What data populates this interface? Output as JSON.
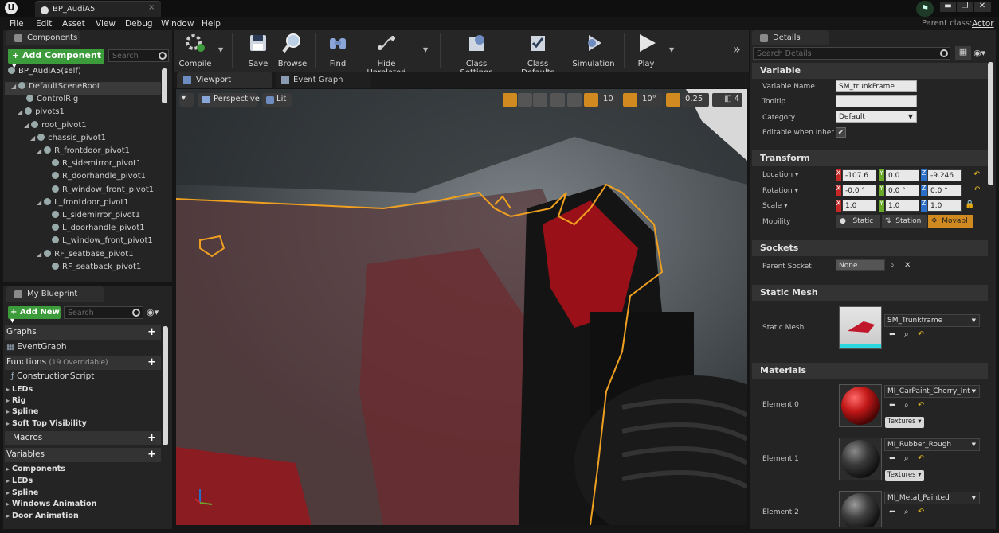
{
  "window": {
    "doc_tab": "BP_AudiA5",
    "parent_class_label": "Parent class:",
    "parent_class_value": "Actor",
    "min": "▬",
    "max": "❐",
    "close": "✕",
    "tab_close": "×"
  },
  "menu": [
    "File",
    "Edit",
    "Asset",
    "View",
    "Debug",
    "Window",
    "Help"
  ],
  "components": {
    "tab": "Components",
    "add_button": "+ Add Component ▾",
    "search_placeholder": "Search",
    "self_item": "BP_AudiA5(self)",
    "tree": [
      {
        "label": "DefaultSceneRoot",
        "indent": 1,
        "expand": "◢",
        "selected": true
      },
      {
        "label": "ControlRig",
        "indent": 2,
        "expand": ""
      },
      {
        "label": "pivots1",
        "indent": 2,
        "expand": "◢"
      },
      {
        "label": "root_pivot1",
        "indent": 3,
        "expand": "◢"
      },
      {
        "label": "chassis_pivot1",
        "indent": 4,
        "expand": "◢"
      },
      {
        "label": "R_frontdoor_pivot1",
        "indent": 5,
        "expand": "◢"
      },
      {
        "label": "R_sidemirror_pivot1",
        "indent": 6,
        "expand": ""
      },
      {
        "label": "R_doorhandle_pivot1",
        "indent": 6,
        "expand": ""
      },
      {
        "label": "R_window_front_pivot1",
        "indent": 6,
        "expand": ""
      },
      {
        "label": "L_frontdoor_pivot1",
        "indent": 5,
        "expand": "◢"
      },
      {
        "label": "L_sidemirror_pivot1",
        "indent": 6,
        "expand": ""
      },
      {
        "label": "L_doorhandle_pivot1",
        "indent": 6,
        "expand": ""
      },
      {
        "label": "L_window_front_pivot1",
        "indent": 6,
        "expand": ""
      },
      {
        "label": "RF_seatbase_pivot1",
        "indent": 5,
        "expand": "◢"
      },
      {
        "label": "RF_seatback_pivot1",
        "indent": 6,
        "expand": ""
      }
    ]
  },
  "my_blueprint": {
    "tab": "My Blueprint",
    "add_button": "+ Add New ▾",
    "search_placeholder": "Search",
    "graphs_header": "Graphs",
    "event_graph": "EventGraph",
    "functions_header": "Functions",
    "functions_overridable": "(19 Overridable)",
    "construction_script": "ConstructionScript",
    "function_items": [
      "LEDs",
      "Rig",
      "Spline",
      "Soft Top Visibility"
    ],
    "macros_header": "Macros",
    "variables_header": "Variables",
    "variable_items": [
      "Components",
      "LEDs",
      "Spline",
      "Windows Animation",
      "Door Animation"
    ]
  },
  "toolbar": {
    "buttons": [
      {
        "label": "Compile",
        "icon": "compile-icon"
      },
      {
        "label": "Save",
        "icon": "save-icon"
      },
      {
        "label": "Browse",
        "icon": "browse-icon"
      },
      {
        "label": "Find",
        "icon": "find-icon"
      },
      {
        "label": "Hide Unrelated",
        "icon": "hide-unrelated-icon"
      },
      {
        "label": "Class Settings",
        "icon": "class-settings-icon"
      },
      {
        "label": "Class Defaults",
        "icon": "class-defaults-icon"
      },
      {
        "label": "Simulation",
        "icon": "simulation-icon"
      },
      {
        "label": "Play",
        "icon": "play-icon"
      }
    ],
    "more": "»"
  },
  "editor_tabs": {
    "viewport": "Viewport",
    "event_graph": "Event Graph"
  },
  "viewport": {
    "perspective": "Perspective",
    "lit": "Lit",
    "grid_snap": "10",
    "rot_snap": "10°",
    "scale_snap": "0.25",
    "camera_speed": "4"
  },
  "details": {
    "tab": "Details",
    "search_placeholder": "Search Details",
    "variable_section": "Variable",
    "variable_name_label": "Variable Name",
    "variable_name_value": "SM_trunkFrame",
    "tooltip_label": "Tooltip",
    "tooltip_value": "",
    "category_label": "Category",
    "category_value": "Default",
    "editable_label": "Editable when Inherited",
    "editable_checked": "✔",
    "transform_section": "Transform",
    "location_label": "Location ▾",
    "location": [
      "-107.6",
      "0.0",
      "-9.246"
    ],
    "rotation_label": "Rotation ▾",
    "rotation": [
      "-0.0 °",
      "0.0 °",
      "0.0 °"
    ],
    "scale_label": "Scale ▾",
    "scale": [
      "1.0",
      "1.0",
      "1.0"
    ],
    "mobility_label": "Mobility",
    "mobility_options": [
      "Static",
      "Station",
      "Movabl"
    ],
    "sockets_section": "Sockets",
    "parent_socket_label": "Parent Socket",
    "parent_socket_value": "None",
    "static_mesh_section": "Static Mesh",
    "static_mesh_label": "Static Mesh",
    "static_mesh_value": "SM_Trunkframe",
    "materials_section": "Materials",
    "materials": [
      {
        "label": "Element 0",
        "value": "MI_CarPaint_Cherry_Int",
        "textures": "Textures ▾"
      },
      {
        "label": "Element 1",
        "value": "MI_Rubber_Rough",
        "textures": "Textures ▾"
      },
      {
        "label": "Element 2",
        "value": "MI_Metal_Painted",
        "textures": ""
      }
    ]
  },
  "colors": {
    "accent_green": "#3c9b3a",
    "selection_orange": "#f0a020",
    "axis_x": "#c62828",
    "axis_y": "#6aa82a",
    "axis_z": "#2a6ec8"
  }
}
